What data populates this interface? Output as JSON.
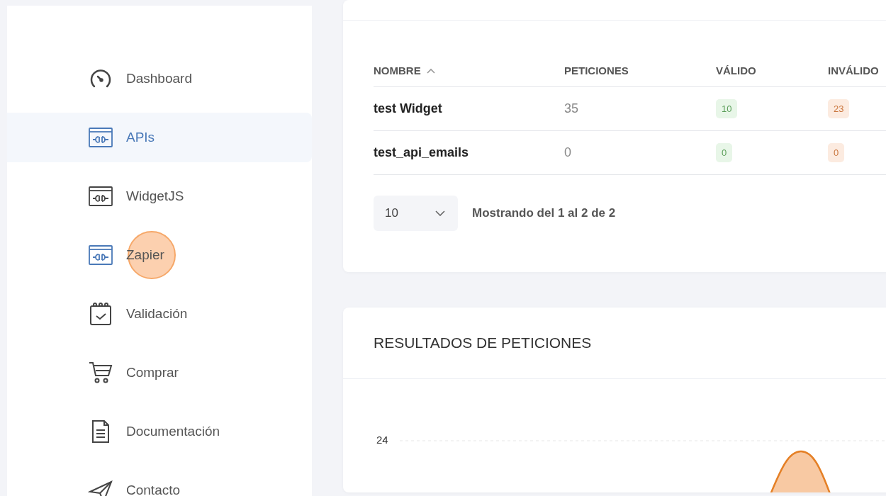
{
  "sidebar": {
    "items": [
      {
        "label": "Dashboard",
        "kind": "gauge",
        "selected": false,
        "highlighted": false
      },
      {
        "label": "APIs",
        "kind": "plug",
        "selected": true,
        "highlighted": false
      },
      {
        "label": "WidgetJS",
        "kind": "plug",
        "selected": false,
        "highlighted": false
      },
      {
        "label": "Zapier",
        "kind": "plug",
        "selected": false,
        "highlighted": true
      },
      {
        "label": "Validación",
        "kind": "calendar",
        "selected": false,
        "highlighted": false
      },
      {
        "label": "Comprar",
        "kind": "cart",
        "selected": false,
        "highlighted": false
      },
      {
        "label": "Documentación",
        "kind": "document",
        "selected": false,
        "highlighted": false
      },
      {
        "label": "Contacto",
        "kind": "send",
        "selected": false,
        "highlighted": false
      }
    ]
  },
  "table": {
    "columns": [
      {
        "label": "NOMBRE",
        "sorted": true
      },
      {
        "label": "PETICIONES",
        "sorted": false
      },
      {
        "label": "VÁLIDO",
        "sorted": false
      },
      {
        "label": "INVÁLIDO",
        "sorted": false
      }
    ],
    "rows": [
      {
        "name": "test Widget",
        "requests": "35",
        "valid": "10",
        "invalid": "23"
      },
      {
        "name": "test_api_emails",
        "requests": "0",
        "valid": "0",
        "invalid": "0"
      }
    ],
    "page_size": "10",
    "summary": "Mostrando del 1 al 2 de 2"
  },
  "results": {
    "title": "RESULTADOS DE PETICIONES",
    "y_tick_labels": [
      "24"
    ]
  }
}
